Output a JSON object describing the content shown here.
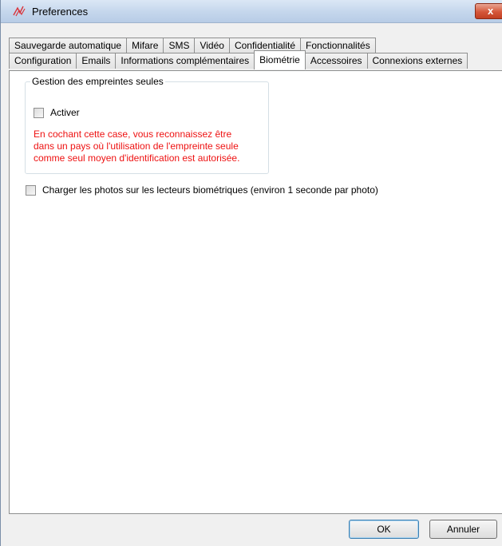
{
  "window": {
    "title": "Preferences",
    "close_glyph": "x",
    "app_icon": "biometric-logo-icon"
  },
  "tabs": {
    "row_back": [
      {
        "label": "Sauvegarde automatique"
      },
      {
        "label": "Mifare"
      },
      {
        "label": "SMS"
      },
      {
        "label": "Vidéo"
      },
      {
        "label": "Confidentialité"
      },
      {
        "label": "Fonctionnalités"
      }
    ],
    "row_front": [
      {
        "label": "Configuration"
      },
      {
        "label": "Emails"
      },
      {
        "label": "Informations complémentaires"
      },
      {
        "label": "Biométrie",
        "selected": true
      },
      {
        "label": "Accessoires"
      },
      {
        "label": "Connexions externes"
      }
    ]
  },
  "biometrie": {
    "group_title": "Gestion des empreintes seules",
    "activate_label": "Activer",
    "activate_checked": false,
    "warning_line1": "En cochant cette case, vous reconnaissez être",
    "warning_line2": "dans un pays où l'utilisation de l'empreinte seule",
    "warning_line3": "comme seul moyen d'identification est autorisée.",
    "load_photos_label": "Charger les photos sur les lecteurs biométriques (environ 1 seconde par photo)",
    "load_photos_checked": false
  },
  "buttons": {
    "ok": "OK",
    "cancel": "Annuler"
  },
  "colors": {
    "warning": "#ee1111",
    "panel": "#ffffff",
    "chrome": "#f0f0f0"
  }
}
